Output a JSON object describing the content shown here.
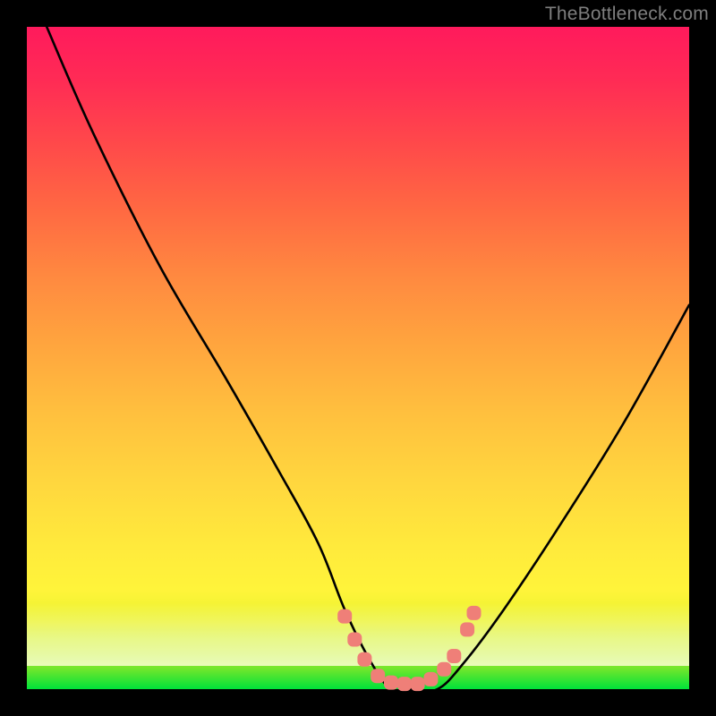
{
  "watermark": "TheBottleneck.com",
  "chart_data": {
    "type": "line",
    "title": "",
    "xlabel": "",
    "ylabel": "",
    "xlim": [
      0,
      100
    ],
    "ylim": [
      0,
      100
    ],
    "grid": false,
    "legend": false,
    "series": [
      {
        "name": "bottleneck-curve",
        "x": [
          3,
          10,
          20,
          30,
          38,
          44,
          48,
          52,
          55,
          58,
          62,
          66,
          72,
          80,
          90,
          100
        ],
        "y": [
          100,
          84,
          64,
          47,
          33,
          22,
          12,
          4,
          0,
          0,
          0,
          4,
          12,
          24,
          40,
          58
        ]
      }
    ],
    "markers": {
      "name": "highlight-dots",
      "color": "#ef7f78",
      "points": [
        {
          "x": 48.0,
          "y": 11.0
        },
        {
          "x": 49.5,
          "y": 7.5
        },
        {
          "x": 51.0,
          "y": 4.5
        },
        {
          "x": 53.0,
          "y": 2.0
        },
        {
          "x": 55.0,
          "y": 1.0
        },
        {
          "x": 57.0,
          "y": 0.8
        },
        {
          "x": 59.0,
          "y": 0.8
        },
        {
          "x": 61.0,
          "y": 1.5
        },
        {
          "x": 63.0,
          "y": 3.0
        },
        {
          "x": 64.5,
          "y": 5.0
        },
        {
          "x": 66.5,
          "y": 9.0
        },
        {
          "x": 67.5,
          "y": 11.5
        }
      ]
    }
  }
}
